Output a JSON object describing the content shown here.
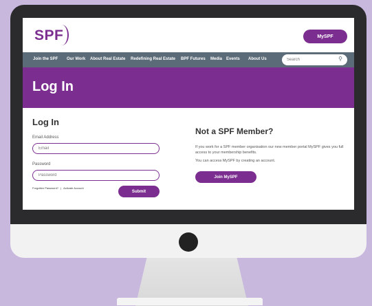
{
  "header": {
    "logo_text": "SPF",
    "myspf_button": "MySPF"
  },
  "nav": {
    "items": [
      {
        "label": "Join the SPF"
      },
      {
        "label": "Our Work"
      },
      {
        "label": "About Real Estate"
      },
      {
        "label": "Redefining Real Estate"
      },
      {
        "label": "BPF Futures"
      },
      {
        "label": "Media"
      },
      {
        "label": "Events"
      },
      {
        "label": "About Us"
      }
    ],
    "search_placeholder": "Search"
  },
  "banner": {
    "title": "Log In"
  },
  "login": {
    "heading": "Log In",
    "email_label": "Email Address",
    "email_placeholder": "Email",
    "password_label": "Password",
    "password_placeholder": "Password",
    "forgotten_password": "Forgotten Password?",
    "separator": "|",
    "activate_account": "Activate Account",
    "submit_label": "Submit"
  },
  "not_member": {
    "heading": "Not a SPF Member?",
    "paragraph1": "If you work for a SPF member organisation our new member portal MySPF gives you full access to your membership benefits.",
    "paragraph2": "You can access MySPF by creating an account.",
    "join_button": "Join MySPF"
  },
  "colors": {
    "brand_purple": "#7b2e8f",
    "nav_gray": "#5b6b77",
    "background_lavender": "#c9b8de"
  }
}
